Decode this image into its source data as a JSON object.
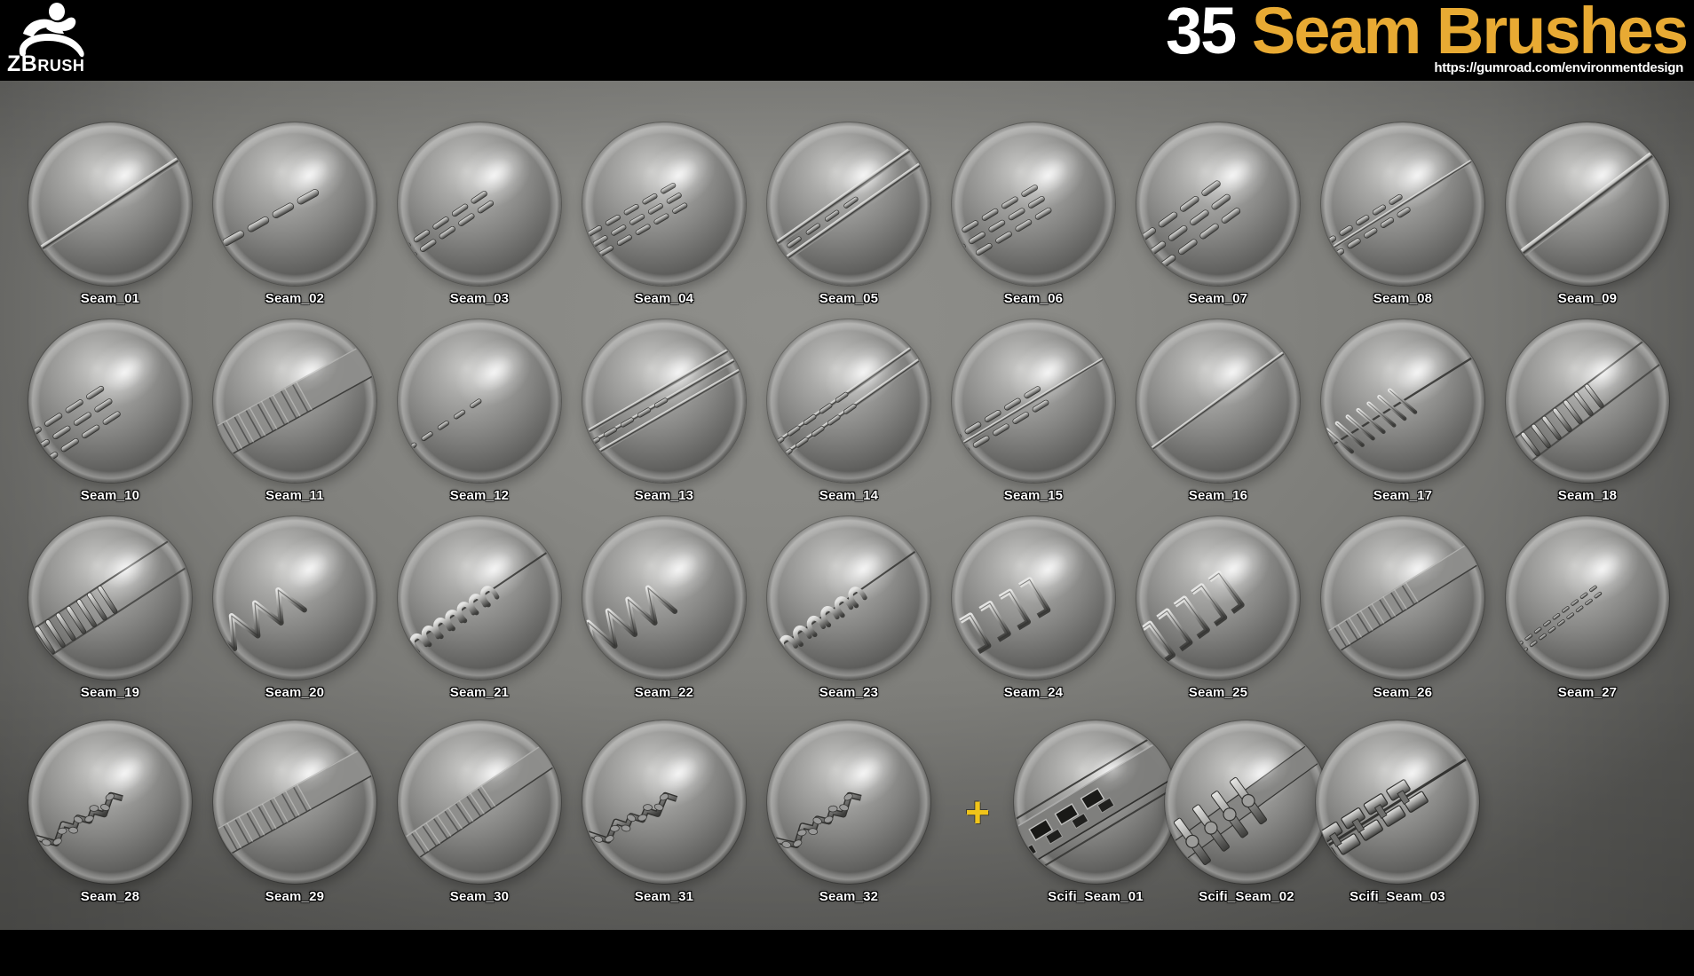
{
  "header": {
    "logo_name": "zbrush-logo",
    "wordmark_z": "Z",
    "wordmark_b": "B",
    "wordmark_rush": "RUSH",
    "title_count": "35",
    "title_main": " Seam Brushes",
    "url": "https://gumroad.com/environmentdesign",
    "accent_color": "#e8aa33",
    "background_color": "#000000"
  },
  "stage": {
    "background_color": "#8a8a86",
    "plus_symbol": "+",
    "plus_color": "#f0c419"
  },
  "grid": {
    "columns": 9,
    "rows": 4,
    "rows_data": [
      [
        {
          "label": "Seam_01",
          "style": "single-groove"
        },
        {
          "label": "Seam_02",
          "style": "dash-chain"
        },
        {
          "label": "Seam_03",
          "style": "double-dash-chain"
        },
        {
          "label": "Seam_04",
          "style": "triple-dash"
        },
        {
          "label": "Seam_05",
          "style": "groove-dash"
        },
        {
          "label": "Seam_06",
          "style": "multi-dash"
        },
        {
          "label": "Seam_07",
          "style": "multi-dash-wide"
        },
        {
          "label": "Seam_08",
          "style": "dash-rib"
        },
        {
          "label": "Seam_09",
          "style": "smooth-groove"
        }
      ],
      [
        {
          "label": "Seam_10",
          "style": "stacked-dash"
        },
        {
          "label": "Seam_11",
          "style": "quilted-roll"
        },
        {
          "label": "Seam_12",
          "style": "short-dash"
        },
        {
          "label": "Seam_13",
          "style": "ribbed-band"
        },
        {
          "label": "Seam_14",
          "style": "ribbed-band-2"
        },
        {
          "label": "Seam_15",
          "style": "dash-band"
        },
        {
          "label": "Seam_16",
          "style": "plain-groove"
        },
        {
          "label": "Seam_17",
          "style": "cross-stitch"
        },
        {
          "label": "Seam_18",
          "style": "ladder-stitch"
        }
      ],
      [
        {
          "label": "Seam_19",
          "style": "ladder-stitch-2"
        },
        {
          "label": "Seam_20",
          "style": "zigzag-stitch"
        },
        {
          "label": "Seam_21",
          "style": "loop-stitch"
        },
        {
          "label": "Seam_22",
          "style": "zigzag-stitch-2"
        },
        {
          "label": "Seam_23",
          "style": "rope-stitch"
        },
        {
          "label": "Seam_24",
          "style": "staple-stitch"
        },
        {
          "label": "Seam_25",
          "style": "staple-stitch-2"
        },
        {
          "label": "Seam_26",
          "style": "rolled-seam"
        },
        {
          "label": "Seam_27",
          "style": "fine-stitch"
        }
      ],
      [
        {
          "label": "Seam_28",
          "style": "rough-seam"
        },
        {
          "label": "Seam_29",
          "style": "padded-seam"
        },
        {
          "label": "Seam_30",
          "style": "padded-seam-2"
        },
        {
          "label": "Seam_31",
          "style": "torn-seam"
        },
        {
          "label": "Seam_32",
          "style": "torn-seam-2"
        },
        {
          "label": "Scifi_Seam_01",
          "style": "scifi-panel"
        },
        {
          "label": "Scifi_Seam_02",
          "style": "scifi-bolt"
        },
        {
          "label": "Scifi_Seam_03",
          "style": "scifi-clamp"
        }
      ]
    ]
  }
}
